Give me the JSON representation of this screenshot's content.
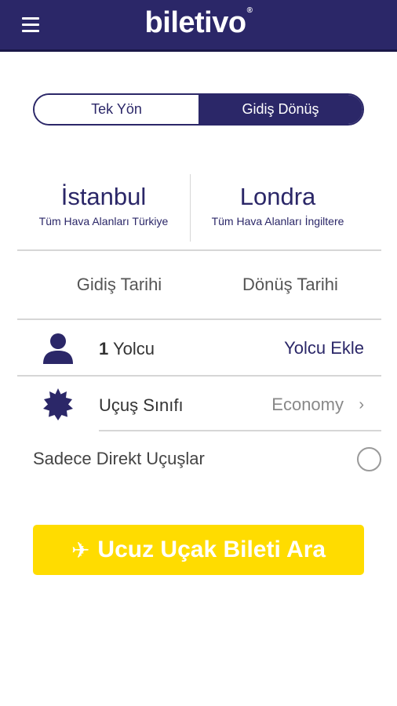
{
  "header": {
    "brand": "biletivo",
    "brand_mark": "®",
    "menu_icon": "hamburger-icon"
  },
  "trip_type": {
    "one_way": "Tek Yön",
    "round_trip": "Gidiş Dönüş",
    "selected": "round_trip"
  },
  "route": {
    "from": {
      "city": "İstanbul",
      "airports": "Tüm Hava Alanları Türkiye"
    },
    "to": {
      "city": "Londra",
      "airports": "Tüm Hava Alanları İngiltere"
    }
  },
  "dates": {
    "departure_placeholder": "Gidiş Tarihi",
    "return_placeholder": "Dönüş Tarihi"
  },
  "passengers": {
    "count": "1",
    "label": "Yolcu",
    "add_label": "Yolcu Ekle",
    "icon": "person-icon"
  },
  "cabin": {
    "label": "Uçuş Sınıfı",
    "value": "Economy",
    "icon": "badge-icon"
  },
  "direct_only": {
    "label": "Sadece Direkt Uçuşlar",
    "checked": false
  },
  "search": {
    "label": "Ucuz Uçak Bileti Ara",
    "icon": "airplane-icon"
  },
  "colors": {
    "primary": "#2b2768",
    "accent": "#ffdc00",
    "divider": "#d6d6d6"
  }
}
